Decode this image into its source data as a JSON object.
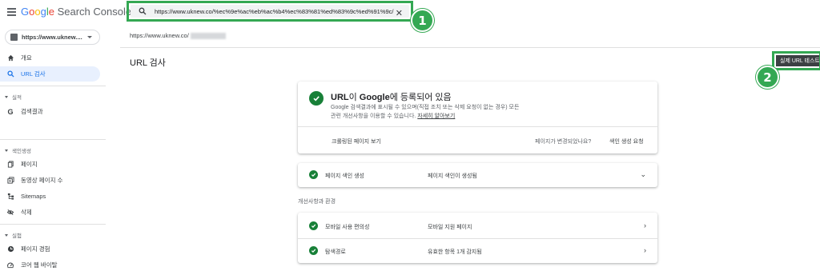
{
  "app": {
    "logo_parts": [
      "G",
      "o",
      "o",
      "g",
      "l",
      "e"
    ],
    "logo_rest": " Search Console"
  },
  "property": {
    "label": "https://www.uknew...."
  },
  "nav": {
    "items_top": [
      {
        "label": "개요",
        "icon": "home-icon"
      },
      {
        "label": "URL 검사",
        "icon": "search-icon",
        "active": true
      }
    ],
    "section_performance": "실적",
    "performance_items": [
      {
        "label": "검색결과",
        "icon": "google-g-icon"
      }
    ],
    "section_indexing": "색인생성",
    "indexing_items": [
      {
        "label": "페이지",
        "icon": "pages-icon"
      },
      {
        "label": "동영상 페이지 수",
        "icon": "video-pages-icon"
      },
      {
        "label": "Sitemaps",
        "icon": "sitemap-icon"
      },
      {
        "label": "삭제",
        "icon": "removal-icon"
      }
    ],
    "section_experience": "실험",
    "experience_items": [
      {
        "label": "페이지 경험",
        "icon": "page-experience-icon"
      },
      {
        "label": "코어 웹 바이탈",
        "icon": "core-web-vitals-icon"
      }
    ]
  },
  "search": {
    "value": "https://www.uknew.co/%ec%9e%ac%eb%ac%b4%ec%83%81%ed%83%9c%ed%91%9c/"
  },
  "annotations": {
    "badge1": "1",
    "badge2": "2"
  },
  "main": {
    "inspected_url": "https://www.uknew.co/",
    "page_title": "URL 검사",
    "test_live_button": "실제 URL 테스트"
  },
  "status_card": {
    "title_prefix": "URL",
    "title_mid": "이 ",
    "title_google": "Google",
    "title_suffix": "에 등록되어 있음",
    "desc_line1": "Google 검색결과에 표시될 수 있으며(직접 조치 또는 삭제 요청이 없는 경우) 모든",
    "desc_line2": "관련 개선사항을 이용할 수 있습니다. ",
    "learn_more": "자세히 알아보기",
    "view_crawled": "크롤링된 페이지 보기",
    "page_changed": "페이지가 변경되었나요?",
    "request_indexing": "색인 생성 요청"
  },
  "indexing_row": {
    "label": "페이지 색인 생성",
    "value": "페이지 색인이 생성됨"
  },
  "enhancements": {
    "section_label": "개선사항과 환경",
    "rows": [
      {
        "label": "모바일 사용 편의성",
        "value": "모바일 지원 페이지"
      },
      {
        "label": "탐색경로",
        "value": "유효한 항목 1개 감지됨"
      }
    ]
  },
  "colors": {
    "accent": "#1a73e8",
    "success": "#188038",
    "annotation": "#34a853"
  }
}
